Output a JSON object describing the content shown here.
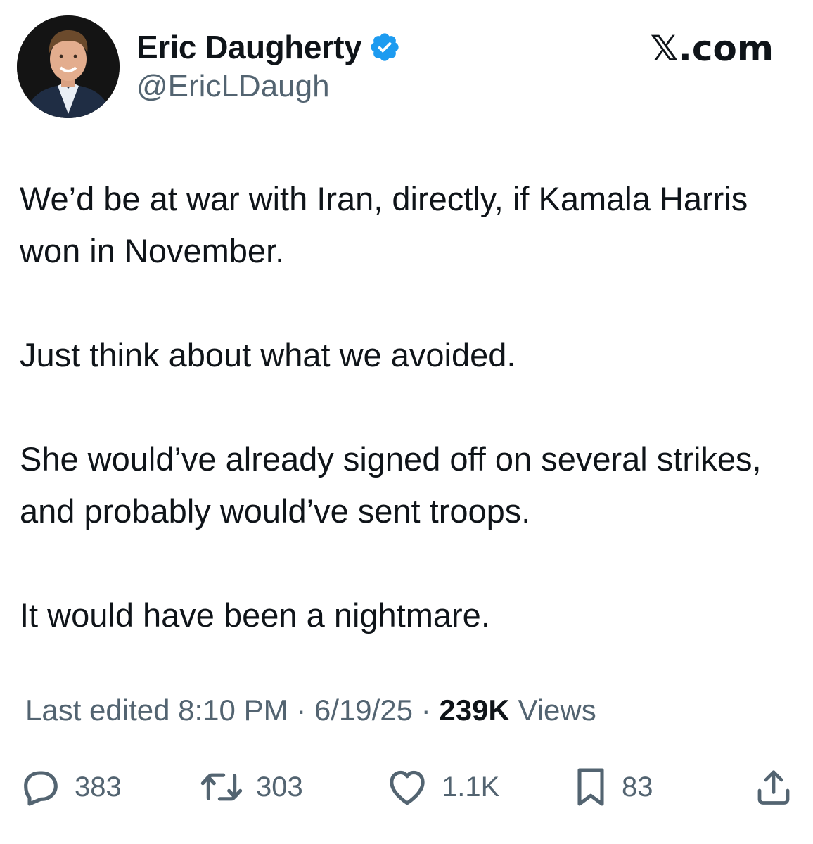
{
  "author": {
    "display_name": "Eric Daugherty",
    "handle": "@EricLDaugh",
    "verified": true,
    "verified_color": "#1d9bf0"
  },
  "site_label": "𝕏.com",
  "tweet": {
    "paragraphs": [
      "We’d be at war with Iran, directly, if Kamala Harris won in November.",
      "Just think about what we avoided.",
      "She would’ve already signed off on several strikes, and probably would’ve sent troops.",
      "It would have been a nightmare."
    ]
  },
  "meta": {
    "edited_prefix": "Last edited 8:10 PM · 6/19/25 · ",
    "views_count": "239K",
    "views_label": "Views"
  },
  "actions": {
    "replies": "383",
    "reposts": "303",
    "likes": "1.1K",
    "bookmarks": "83"
  },
  "colors": {
    "text": "#0f1419",
    "secondary": "#536471"
  }
}
